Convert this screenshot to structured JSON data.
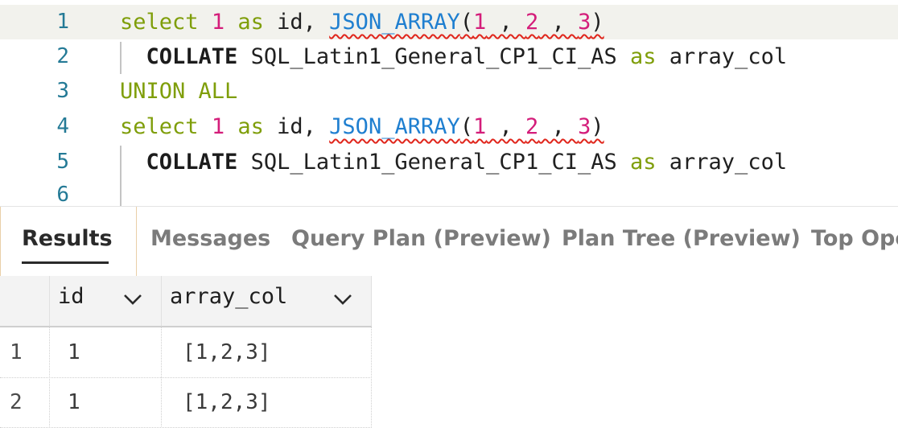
{
  "editor": {
    "lines": [
      {
        "num": "1"
      },
      {
        "num": "2"
      },
      {
        "num": "3"
      },
      {
        "num": "4"
      },
      {
        "num": "5"
      },
      {
        "num": "6"
      }
    ],
    "tokens": {
      "select": "select",
      "one": "1",
      "as": "as",
      "id": "id,",
      "json_array": "JSON_ARRAY",
      "open": "(",
      "a1": "1",
      "sep": " , ",
      "a2": "2",
      "a3": "3",
      "close": ")",
      "collate": "COLLATE",
      "collation": "SQL_Latin1_General_CP1_CI_AS",
      "array_col": "array_col",
      "union_all": "UNION ALL"
    }
  },
  "tabs": {
    "results": "Results",
    "messages": "Messages",
    "query_plan": "Query Plan (Preview)",
    "plan_tree": "Plan Tree (Preview)",
    "top_ops": "Top Operations"
  },
  "grid": {
    "columns": [
      "id",
      "array_col"
    ],
    "rows": [
      {
        "num": "1",
        "id": "1",
        "array_col": "[1,2,3]"
      },
      {
        "num": "2",
        "id": "1",
        "array_col": "[1,2,3]"
      }
    ]
  }
}
